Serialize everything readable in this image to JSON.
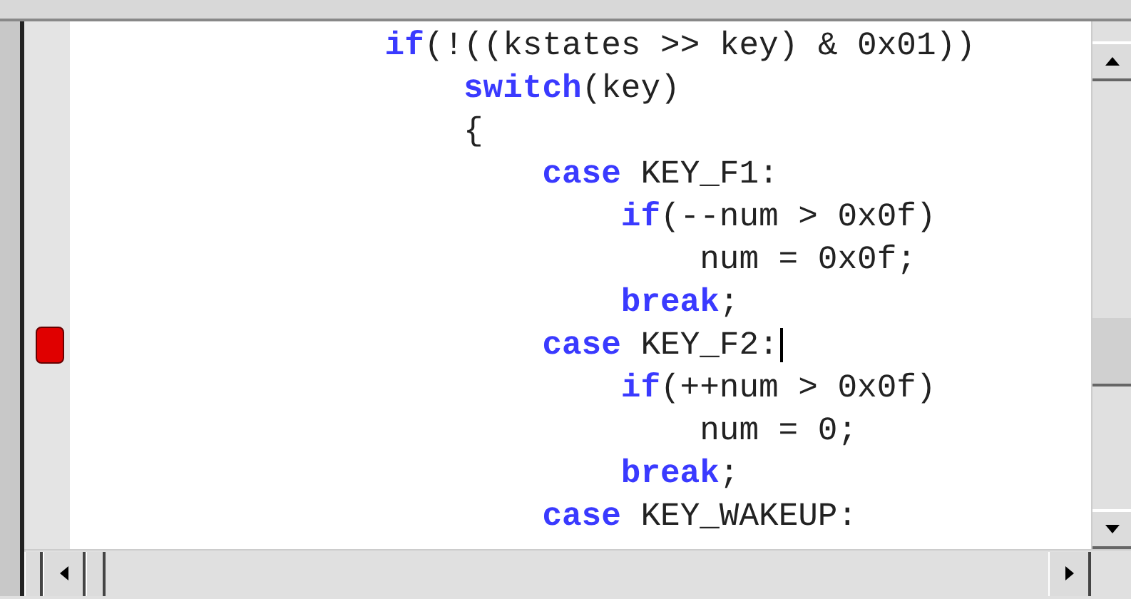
{
  "editor": {
    "lines": [
      {
        "tokens": [
          {
            "kind": "keyword",
            "text": "if"
          },
          {
            "kind": "plain",
            "text": "(!((kstates >> key) & 0x01))"
          }
        ],
        "breakpoint": false,
        "cursor": false,
        "children": [
          {
            "tokens": [
              {
                "kind": "keyword",
                "text": "switch"
              },
              {
                "kind": "plain",
                "text": "(key)"
              }
            ],
            "breakpoint": false,
            "cursor": false
          },
          {
            "tokens": [
              {
                "kind": "plain",
                "text": "{"
              }
            ],
            "breakpoint": false,
            "cursor": false,
            "children": [
              {
                "tokens": [
                  {
                    "kind": "keyword",
                    "text": "case"
                  },
                  {
                    "kind": "plain",
                    "text": " KEY_F1:"
                  }
                ],
                "breakpoint": false,
                "cursor": false,
                "children": [
                  {
                    "tokens": [
                      {
                        "kind": "keyword",
                        "text": "if"
                      },
                      {
                        "kind": "plain",
                        "text": "(--num > 0x0f)"
                      }
                    ],
                    "breakpoint": false,
                    "cursor": false,
                    "children": [
                      {
                        "tokens": [
                          {
                            "kind": "plain",
                            "text": "num = 0x0f;"
                          }
                        ],
                        "breakpoint": false,
                        "cursor": false
                      }
                    ]
                  },
                  {
                    "tokens": [
                      {
                        "kind": "keyword",
                        "text": "break"
                      },
                      {
                        "kind": "plain",
                        "text": ";"
                      }
                    ],
                    "breakpoint": false,
                    "cursor": false
                  }
                ]
              },
              {
                "tokens": [
                  {
                    "kind": "keyword",
                    "text": "case"
                  },
                  {
                    "kind": "plain",
                    "text": " KEY_F2:"
                  }
                ],
                "breakpoint": true,
                "cursor": true,
                "children": [
                  {
                    "tokens": [
                      {
                        "kind": "keyword",
                        "text": "if"
                      },
                      {
                        "kind": "plain",
                        "text": "(++num > 0x0f)"
                      }
                    ],
                    "breakpoint": false,
                    "cursor": false,
                    "children": [
                      {
                        "tokens": [
                          {
                            "kind": "plain",
                            "text": "num = 0;"
                          }
                        ],
                        "breakpoint": false,
                        "cursor": false
                      }
                    ]
                  },
                  {
                    "tokens": [
                      {
                        "kind": "keyword",
                        "text": "break"
                      },
                      {
                        "kind": "plain",
                        "text": ";"
                      }
                    ],
                    "breakpoint": false,
                    "cursor": false
                  }
                ]
              },
              {
                "tokens": [
                  {
                    "kind": "keyword",
                    "text": "case"
                  },
                  {
                    "kind": "plain",
                    "text": " KEY_WAKEUP:"
                  }
                ],
                "breakpoint": false,
                "cursor": false
              }
            ]
          }
        ]
      }
    ]
  }
}
